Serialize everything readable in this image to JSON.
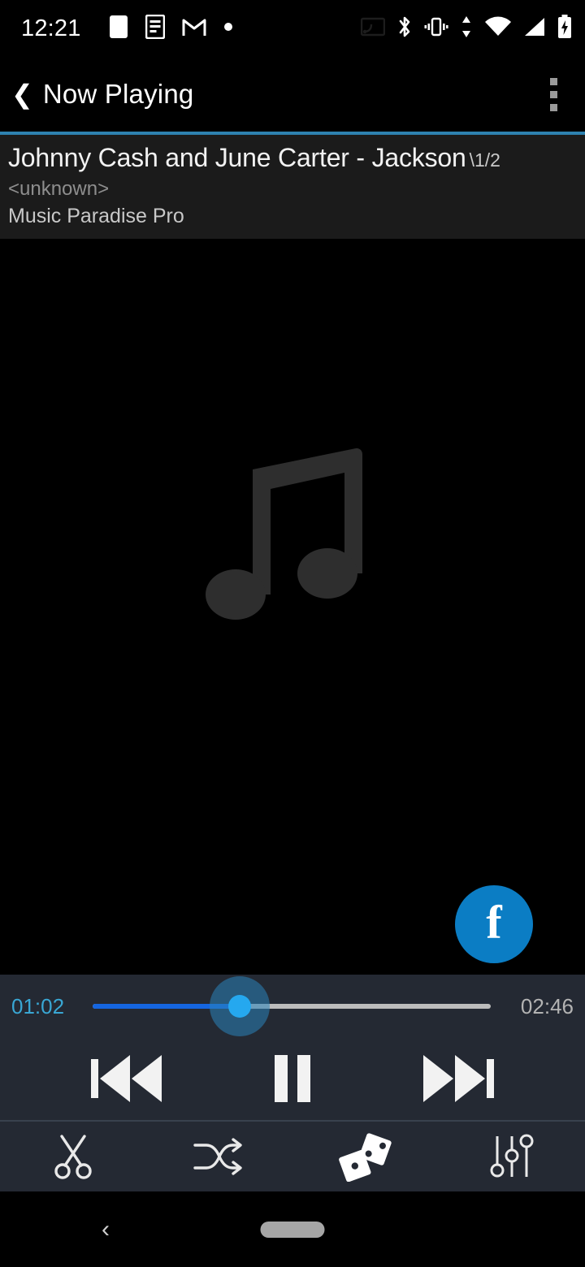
{
  "status_bar": {
    "clock": "12:21",
    "left_icons": [
      "blank-notification-icon",
      "feed-notification-icon",
      "gmail-icon",
      "dot-notification-icon"
    ],
    "right_icons": [
      "cast-disabled-icon",
      "bluetooth-icon",
      "vibrate-icon",
      "mobile-data-arrows-icon",
      "wifi-icon",
      "signal-icon",
      "battery-charging-icon"
    ],
    "wifi_label": "5"
  },
  "app_bar": {
    "back_label": "❮",
    "title": "Now Playing",
    "overflow_label": "more-options"
  },
  "track": {
    "title": "Johnny Cash and June Carter - Jackson",
    "count": "\\1/2",
    "artist": "<unknown>",
    "album": "Music Paradise Pro"
  },
  "artwork": {
    "placeholder": "music-note-placeholder"
  },
  "fab": {
    "label": "f",
    "name": "facebook-share-button",
    "color": "#0b7dc4"
  },
  "player": {
    "elapsed": "01:02",
    "total": "02:46",
    "progress_percent": 37,
    "fill_color": "#1565e0",
    "track_color": "#bcbcbc",
    "thumb_color": "#25a8ef",
    "elapsed_color": "#39a7d4"
  },
  "transport": {
    "previous_label": "previous-track",
    "playpause_label": "pause",
    "next_label": "next-track",
    "state": "playing"
  },
  "toolbar": {
    "items": [
      {
        "name": "cut-ringtone-icon",
        "label": "cut"
      },
      {
        "name": "shuffle-icon",
        "label": "shuffle"
      },
      {
        "name": "dice-random-icon",
        "label": "random"
      },
      {
        "name": "equalizer-icon",
        "label": "equalizer"
      }
    ]
  },
  "nav_bar": {
    "back_label": "‹",
    "home_pill": "home-gesture-pill"
  },
  "theme": {
    "background": "#000000",
    "info_panel": "#1b1b1b",
    "panel": "#242933",
    "accent_rule": "#2e82b0",
    "note_gray": "#2e2e2e"
  }
}
